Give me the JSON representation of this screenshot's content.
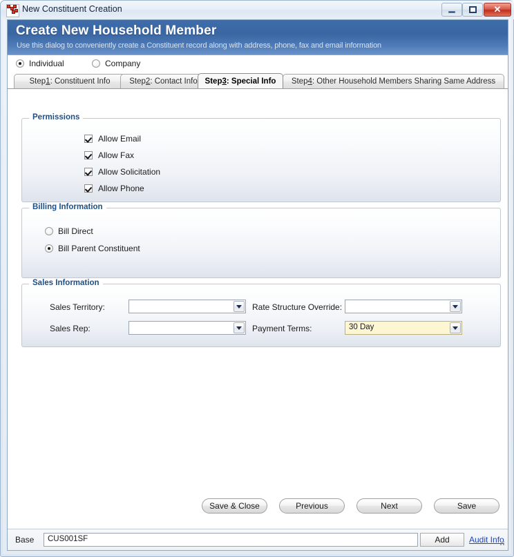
{
  "window": {
    "title": "New Constituent Creation",
    "icon": "app-document-icon",
    "controls": {
      "minimize": "minimize-icon",
      "maximize": "maximize-icon",
      "close": "✕"
    }
  },
  "banner": {
    "title": "Create New Household Member",
    "subtitle": "Use this dialog to conveniently create a Constituent record along with address, phone, fax and email information",
    "bg_color": "#3a66a2"
  },
  "entity_type": {
    "options": [
      {
        "label": "Individual",
        "checked": true
      },
      {
        "label": "Company",
        "checked": false
      }
    ]
  },
  "tabs": [
    {
      "prefix": "Step ",
      "accel": "1",
      "suffix": ": Constituent Info",
      "label": "Step 1: Constituent Info",
      "active": false
    },
    {
      "prefix": "Step ",
      "accel": "2",
      "suffix": ": Contact Info",
      "label": "Step 2: Contact Info",
      "active": false
    },
    {
      "prefix": "Step ",
      "accel": "3",
      "suffix": ": Special Info",
      "label": "Step 3: Special Info",
      "active": true
    },
    {
      "prefix": "Step ",
      "accel": "4",
      "suffix": ": Other Household Members Sharing Same Address",
      "label": "Step 4: Other Household Members Sharing Same Address",
      "active": false
    }
  ],
  "permissions": {
    "title": "Permissions",
    "items": [
      {
        "label": "Allow Email",
        "checked": true
      },
      {
        "label": "Allow Fax",
        "checked": true
      },
      {
        "label": "Allow Solicitation",
        "checked": true
      },
      {
        "label": "Allow Phone",
        "checked": true
      }
    ]
  },
  "billing": {
    "title": "Billing Information",
    "options": [
      {
        "label": "Bill Direct",
        "checked": false
      },
      {
        "label": "Bill Parent Constituent",
        "checked": true
      }
    ]
  },
  "sales": {
    "title": "Sales Information",
    "fields": [
      {
        "label": "Sales Territory:",
        "value": "",
        "highlight": false
      },
      {
        "label": "Sales Rep:",
        "value": "",
        "highlight": false
      },
      {
        "label": "Rate Structure Override:",
        "value": "",
        "highlight": false
      },
      {
        "label": "Payment Terms:",
        "value": "30 Day",
        "highlight": true
      }
    ],
    "highlight_color": "#fdf6d3"
  },
  "buttons": {
    "save_close": "Save & Close",
    "previous": "Previous",
    "next": "Next",
    "save": "Save"
  },
  "statusbar": {
    "label": "Base",
    "value": "CUS001SF",
    "add_label": "Add",
    "audit_link": "Audit Info"
  }
}
